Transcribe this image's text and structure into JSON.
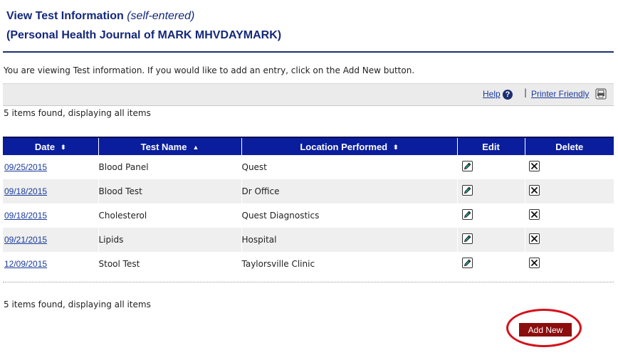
{
  "header": {
    "title": "View Test Information",
    "title_note": "(self-entered)",
    "journal": "(Personal Health Journal of MARK MHVDAYMARK)"
  },
  "intro_text": "You are viewing Test information. If you would like to add an entry, click on the Add New button.",
  "toolbar": {
    "help_label": "Help",
    "separator": "|",
    "printer_label": "Printer Friendly"
  },
  "results": {
    "count_top": "5 items found, displaying all items",
    "count_bottom": "5 items found, displaying all items"
  },
  "table": {
    "columns": [
      "Date",
      "Test Name",
      "Location Performed",
      "Edit",
      "Delete"
    ],
    "sort_markers": [
      "⬍",
      "▲",
      "⬍",
      "",
      ""
    ],
    "rows": [
      {
        "date": "09/25/2015",
        "test_name": "Blood Panel",
        "location": "Quest"
      },
      {
        "date": "09/18/2015",
        "test_name": "Blood Test",
        "location": "Dr Office"
      },
      {
        "date": "09/18/2015",
        "test_name": "Cholesterol",
        "location": "Quest Diagnostics"
      },
      {
        "date": "09/21/2015",
        "test_name": "Lipids",
        "location": "Hospital"
      },
      {
        "date": "12/09/2015",
        "test_name": "Stool Test",
        "location": "Taylorsville Clinic"
      }
    ]
  },
  "actions": {
    "add_new_label": "Add New"
  },
  "icons": {
    "help": "help-icon",
    "printer": "printer-icon",
    "edit": "pencil-icon",
    "delete": "delete-x-icon",
    "sort": "sort-arrows-icon"
  },
  "colors": {
    "title": "#14287a",
    "table_header": "#0a1d9c",
    "add_new_button": "#8b0d0d",
    "highlight_ring": "#d4111b",
    "link": "#1a3a9a"
  }
}
